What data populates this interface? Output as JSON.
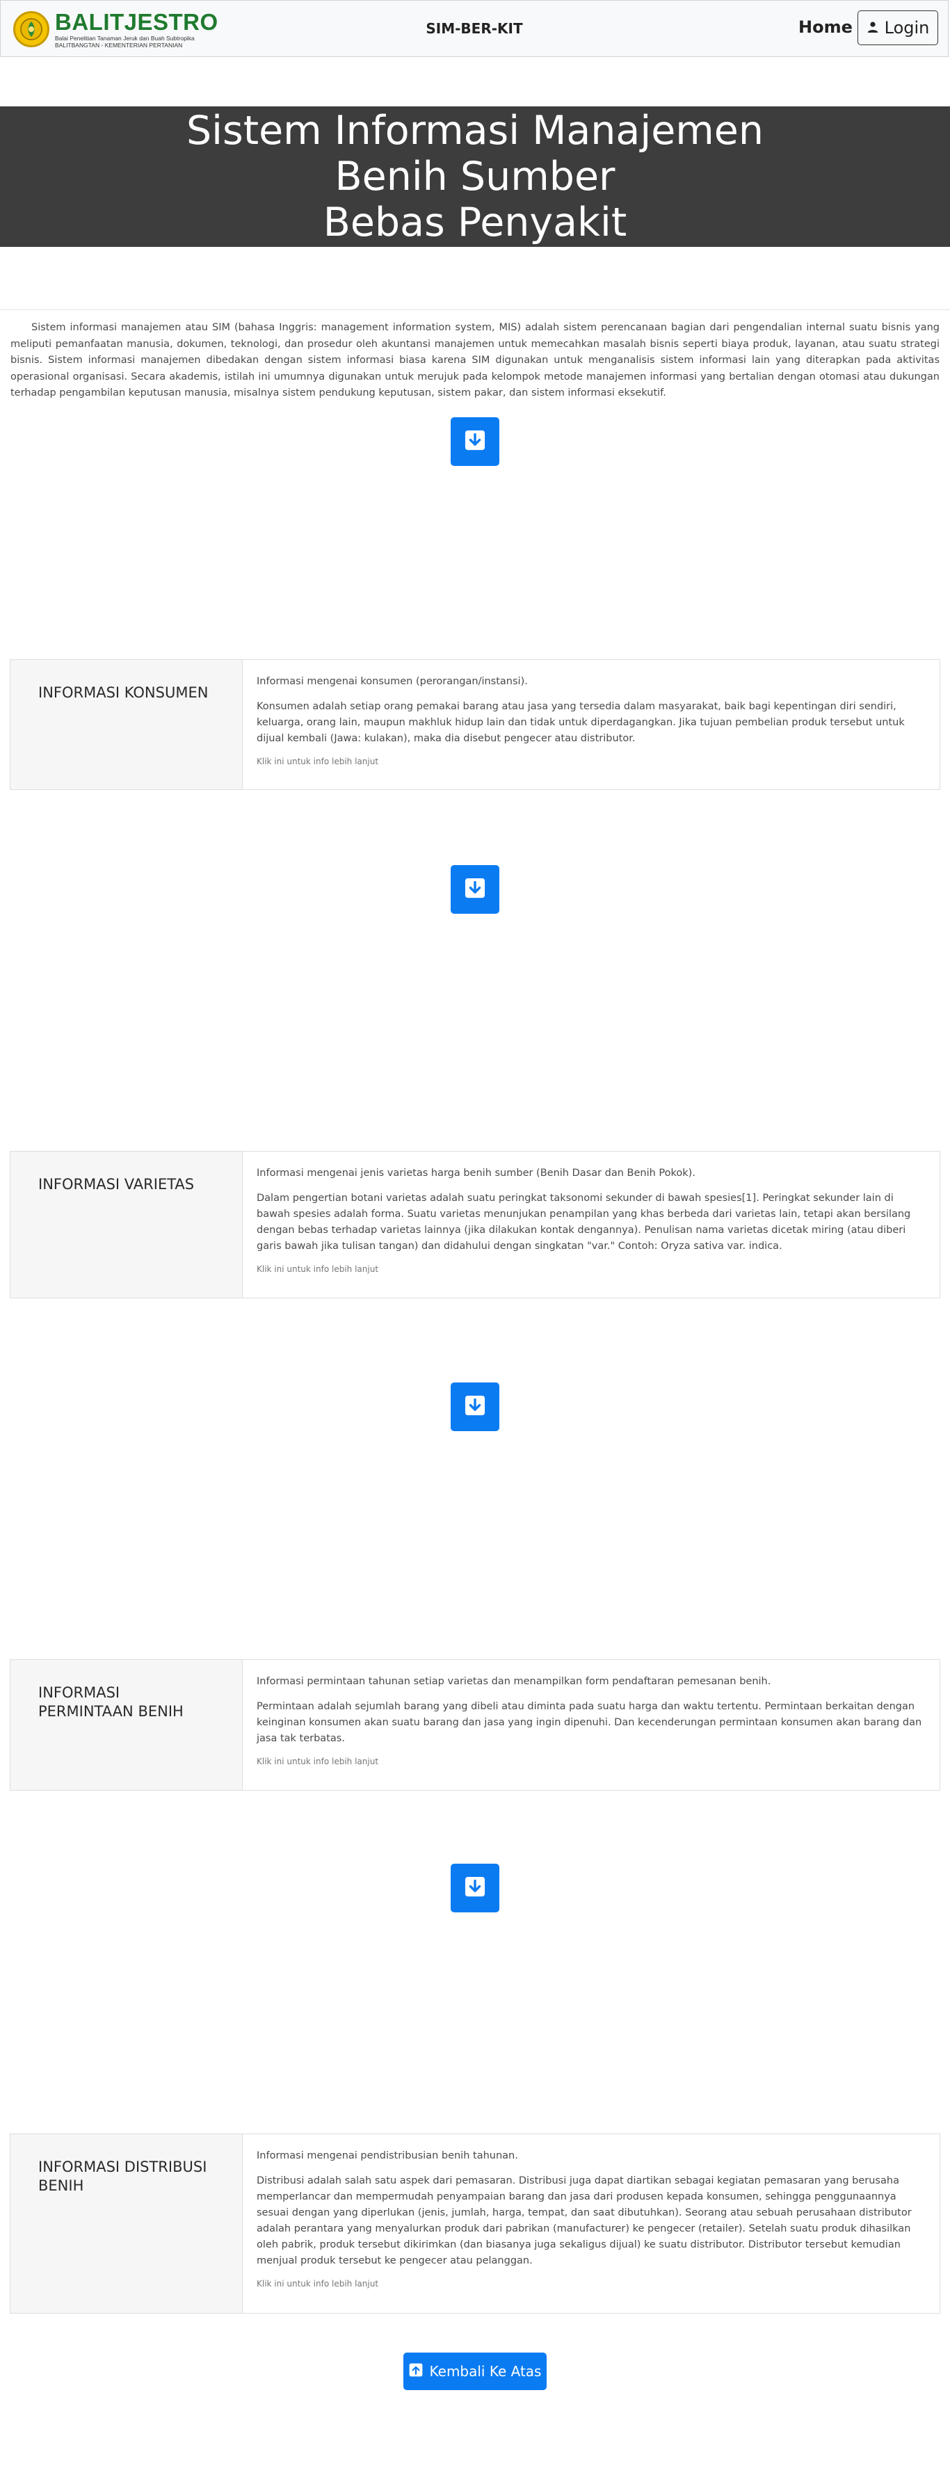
{
  "navbar": {
    "logo_title": "BALITJESTRO",
    "logo_subtitle": "Balai Penelitian Tanaman Jeruk dan Buah Subtropika",
    "logo_subtitle2": "BALITBANGTAN - KEMENTERIAN PERTANIAN",
    "brand": "SIM-BER-KIT",
    "home": "Home",
    "login": "Login"
  },
  "hero": {
    "line1": "Sistem Informasi Manajemen",
    "line2": "Benih Sumber",
    "line3": "Bebas Penyakit"
  },
  "intro": "Sistem informasi manajemen atau SIM (bahasa Inggris: management information system, MIS) adalah sistem perencanaan bagian dari pengendalian internal suatu bisnis yang meliputi pemanfaatan manusia, dokumen, teknologi, dan prosedur oleh akuntansi manajemen untuk memecahkan masalah bisnis seperti biaya produk, layanan, atau suatu strategi bisnis. Sistem informasi manajemen dibedakan dengan sistem informasi biasa karena SIM digunakan untuk menganalisis sistem informasi lain yang diterapkan pada aktivitas operasional organisasi. Secara akademis, istilah ini umumnya digunakan untuk merujuk pada kelompok metode manajemen informasi yang bertalian dengan otomasi atau dukungan terhadap pengambilan keputusan manusia, misalnya sistem pendukung keputusan, sistem pakar, dan sistem informasi eksekutif.",
  "cards": [
    {
      "title": "INFORMASI KONSUMEN",
      "lead": "Informasi mengenai konsumen (perorangan/instansi).",
      "text": "Konsumen adalah setiap orang pemakai barang atau jasa yang tersedia dalam masyarakat, baik bagi kepentingan diri sendiri, keluarga, orang lain, maupun makhluk hidup lain dan tidak untuk diperdagangkan. Jika tujuan pembelian produk tersebut untuk dijual kembali (Jawa: kulakan), maka dia disebut pengecer atau distributor.",
      "more": "Klik ini untuk info lebih lanjut"
    },
    {
      "title": "INFORMASI VARIETAS",
      "lead": "Informasi mengenai jenis varietas harga benih sumber (Benih Dasar dan Benih Pokok).",
      "text": "Dalam pengertian botani varietas adalah suatu peringkat taksonomi sekunder di bawah spesies[1]. Peringkat sekunder lain di bawah spesies adalah forma. Suatu varietas menunjukan penampilan yang khas berbeda dari varietas lain, tetapi akan bersilang dengan bebas terhadap varietas lainnya (jika dilakukan kontak dengannya). Penulisan nama varietas dicetak miring (atau diberi garis bawah jika tulisan tangan) dan didahului dengan singkatan \"var.\" Contoh: Oryza sativa var. indica.",
      "more": "Klik ini untuk info lebih lanjut"
    },
    {
      "title": "INFORMASI PERMINTAAN BENIH",
      "lead": "Informasi permintaan tahunan setiap varietas dan menampilkan form pendaftaran pemesanan benih.",
      "text": "Permintaan adalah sejumlah barang yang dibeli atau diminta pada suatu harga dan waktu tertentu. Permintaan berkaitan dengan keinginan konsumen akan suatu barang dan jasa yang ingin dipenuhi. Dan kecenderungan permintaan konsumen akan barang dan jasa tak terbatas.",
      "more": "Klik ini untuk info lebih lanjut"
    },
    {
      "title": "INFORMASI DISTRIBUSI BENIH",
      "lead": "Informasi mengenai pendistribusian benih tahunan.",
      "text": "Distribusi adalah salah satu aspek dari pemasaran. Distribusi juga dapat diartikan sebagai kegiatan pemasaran yang berusaha memperlancar dan mempermudah penyampaian barang dan jasa dari produsen kepada konsumen, sehingga penggunaannya sesuai dengan yang diperlukan (jenis, jumlah, harga, tempat, dan saat dibutuhkan). Seorang atau sebuah perusahaan distributor adalah perantara yang menyalurkan produk dari pabrikan (manufacturer) ke pengecer (retailer). Setelah suatu produk dihasilkan oleh pabrik, produk tersebut dikirimkan (dan biasanya juga sekaligus dijual) ke suatu distributor. Distributor tersebut kemudian menjual produk tersebut ke pengecer atau pelanggan.",
      "more": "Klik ini untuk info lebih lanjut"
    }
  ],
  "back_to_top": "Kembali Ke Atas",
  "colors": {
    "primary": "#0b7bf2",
    "hero_bg": "#3d3d3d",
    "logo_green": "#1f7a2e"
  },
  "icons": {
    "scroll": "arrow-down-square-icon",
    "login": "person-icon",
    "top": "arrow-up-square-icon"
  }
}
